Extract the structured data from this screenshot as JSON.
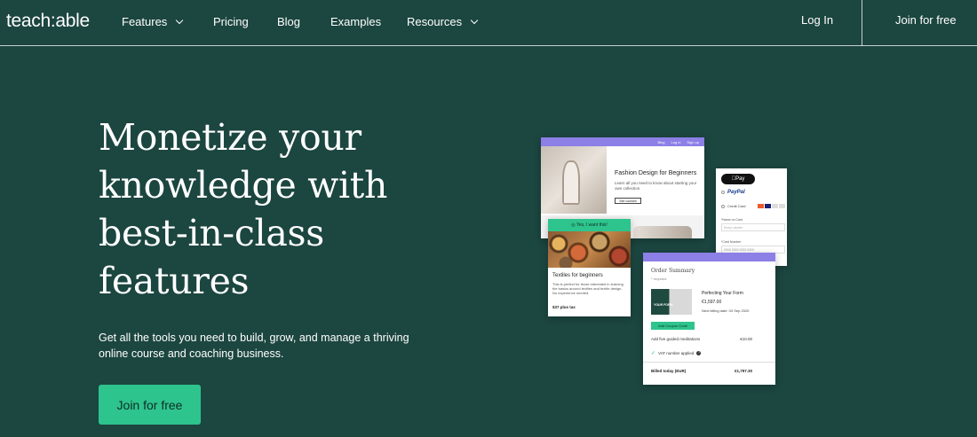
{
  "nav": {
    "logo": "teach:able",
    "links": [
      "Features",
      "Pricing",
      "Blog",
      "Examples",
      "Resources"
    ],
    "login": "Log In",
    "join": "Join for free"
  },
  "hero": {
    "title_lines": [
      "Monetize your",
      "knowledge with",
      "best-in-class",
      "features"
    ],
    "subtitle_lines": [
      "Get all the tools you need to build, grow, and manage a thriving",
      "online course and coaching business."
    ],
    "cta": "Join for free"
  },
  "mockups": {
    "course_page": {
      "nav": [
        "Blog",
        "Log in",
        "Sign up"
      ],
      "title": "Fashion Design for Beginners",
      "description": "Learn all you need to know about starting your own collection",
      "button": "See courses"
    },
    "payment": {
      "apple_pay": "Pay",
      "paypal": "PayPal",
      "credit_card": "Credit Card",
      "name_label": "*Name on Card",
      "name_placeholder": "Emily Lainder",
      "card_label": "*Card Number",
      "card_placeholder": "5555 5555 5555 5555"
    },
    "product_card": {
      "badge": "Yes, I want this!",
      "title": "Textiles for beginners",
      "description": "This is perfect for those interested in learning the basics around textiles and textile design. No experience needed.",
      "price": "$37 plus tax"
    },
    "order": {
      "heading": "Order Summary",
      "required": "* required",
      "img_text": "YOUR FORM",
      "product": "Perfecting Your Form",
      "price": "€1,597.00",
      "next_billing": "Next billing date: 03 Sep 2020",
      "coupon": "Add Coupon Code",
      "addon": "Add five guided meditations",
      "addon_amount": "€10.00",
      "vat": "VAT number applied",
      "total_label": "Billed today (EUR)",
      "total_amount": "€1,797.30"
    }
  },
  "colors": {
    "background": "#1c4640",
    "accent": "#2ec48d",
    "mockup_bar": "#8c7fe6"
  }
}
